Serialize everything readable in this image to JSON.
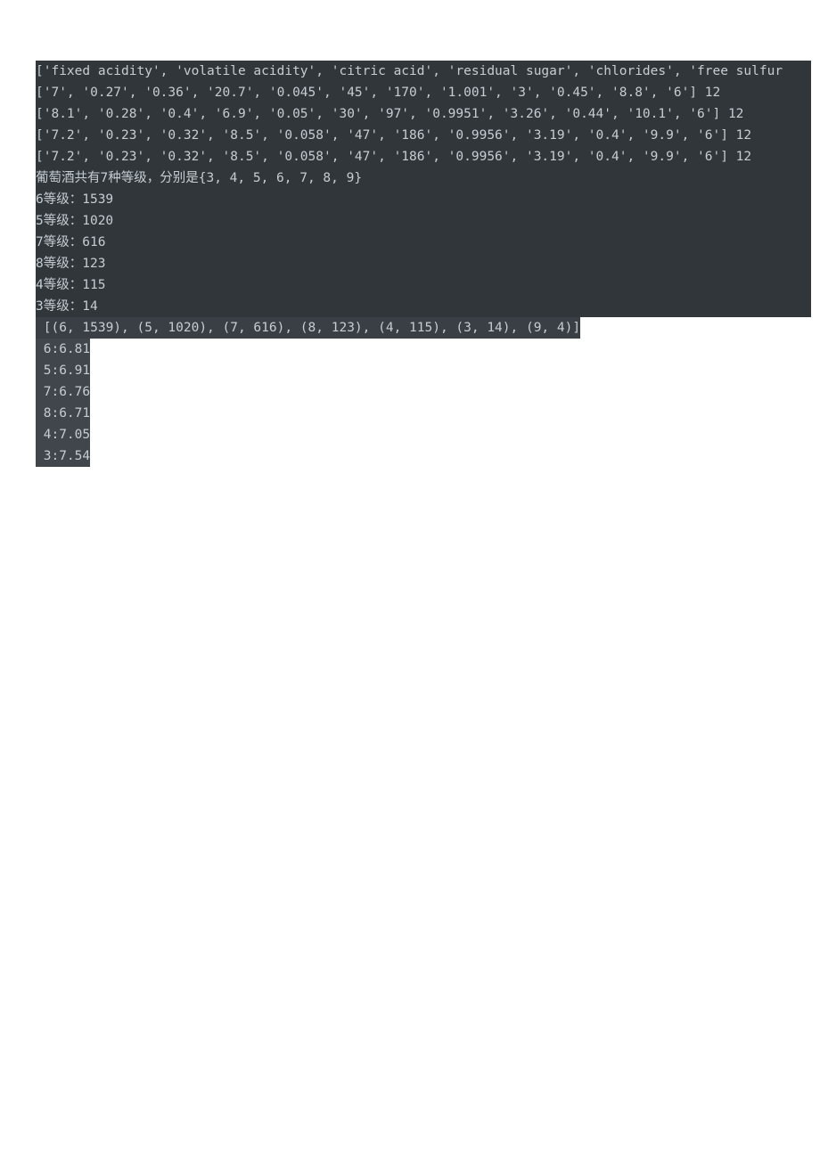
{
  "lines": [
    {
      "bg": "dark",
      "full": true,
      "text": "['fixed acidity', 'volatile acidity', 'citric acid', 'residual sugar', 'chlorides', 'free sulfur"
    },
    {
      "bg": "dark",
      "full": true,
      "text": "['7', '0.27', '0.36', '20.7', '0.045', '45', '170', '1.001', '3', '0.45', '8.8', '6'] 12"
    },
    {
      "bg": "dark",
      "full": true,
      "text": "['8.1', '0.28', '0.4', '6.9', '0.05', '30', '97', '0.9951', '3.26', '0.44', '10.1', '6'] 12"
    },
    {
      "bg": "dark",
      "full": true,
      "text": "['7.2', '0.23', '0.32', '8.5', '0.058', '47', '186', '0.9956', '3.19', '0.4', '9.9', '6'] 12"
    },
    {
      "bg": "dark",
      "full": true,
      "text": "['7.2', '0.23', '0.32', '8.5', '0.058', '47', '186', '0.9956', '3.19', '0.4', '9.9', '6'] 12"
    },
    {
      "bg": "dark",
      "full": true,
      "text": "葡萄酒共有7种等级，分别是{3, 4, 5, 6, 7, 8, 9}"
    },
    {
      "bg": "dark",
      "full": true,
      "text": "6等级：1539"
    },
    {
      "bg": "dark",
      "full": true,
      "text": "5等级：1020"
    },
    {
      "bg": "dark",
      "full": true,
      "text": "7等级：616"
    },
    {
      "bg": "dark",
      "full": true,
      "text": "8等级：123"
    },
    {
      "bg": "dark",
      "full": true,
      "text": "4等级：115"
    },
    {
      "bg": "dark",
      "full": true,
      "text": "3等级：14"
    },
    {
      "bg": "medium",
      "full": false,
      "text": " [(6, 1539), (5, 1020), (7, 616), (8, 123), (4, 115), (3, 14), (9, 4)]"
    },
    {
      "bg": "light",
      "full": false,
      "text": " 6:6.81"
    },
    {
      "bg": "light",
      "full": false,
      "text": " 5:6.91"
    },
    {
      "bg": "light",
      "full": false,
      "text": " 7:6.76"
    },
    {
      "bg": "light",
      "full": false,
      "text": " 8:6.71"
    },
    {
      "bg": "light",
      "full": false,
      "text": " 4:7.05"
    },
    {
      "bg": "light",
      "full": false,
      "text": " 3:7.54"
    }
  ]
}
